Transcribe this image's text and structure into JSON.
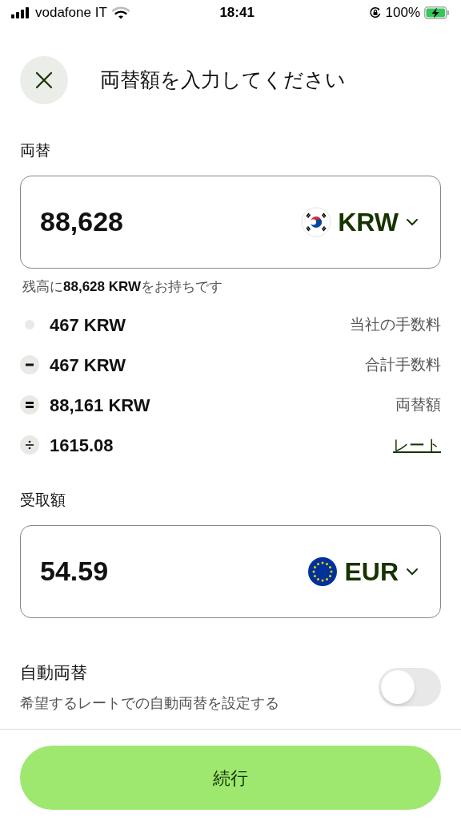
{
  "status_bar": {
    "carrier": "vodafone IT",
    "time": "18:41",
    "battery_percent": "100%"
  },
  "header": {
    "title": "両替額を入力してください"
  },
  "sell": {
    "label": "両替",
    "amount": "88,628",
    "currency": "KRW",
    "flag": {
      "kind": "korea"
    }
  },
  "balance_note": "残高に**88,628 KRW**をお持ちです",
  "breakdown": [
    {
      "kind": "dot",
      "value": "467 KRW",
      "label": "当社の手数料",
      "link": false
    },
    {
      "kind": "minus",
      "value": "467 KRW",
      "label": "合計手数料",
      "link": false
    },
    {
      "kind": "equals",
      "value": "88,161 KRW",
      "label": "両替額",
      "link": false
    },
    {
      "kind": "divide",
      "value": "1615.08",
      "label": "レート",
      "link": true
    }
  ],
  "receive": {
    "label": "受取額",
    "amount": "54.59",
    "currency": "EUR",
    "flag": {
      "kind": "eu"
    }
  },
  "auto_exchange": {
    "title": "自動両替",
    "subtitle": "希望するレートでの自動両替を設定する",
    "on": false
  },
  "continue_button": "続行"
}
